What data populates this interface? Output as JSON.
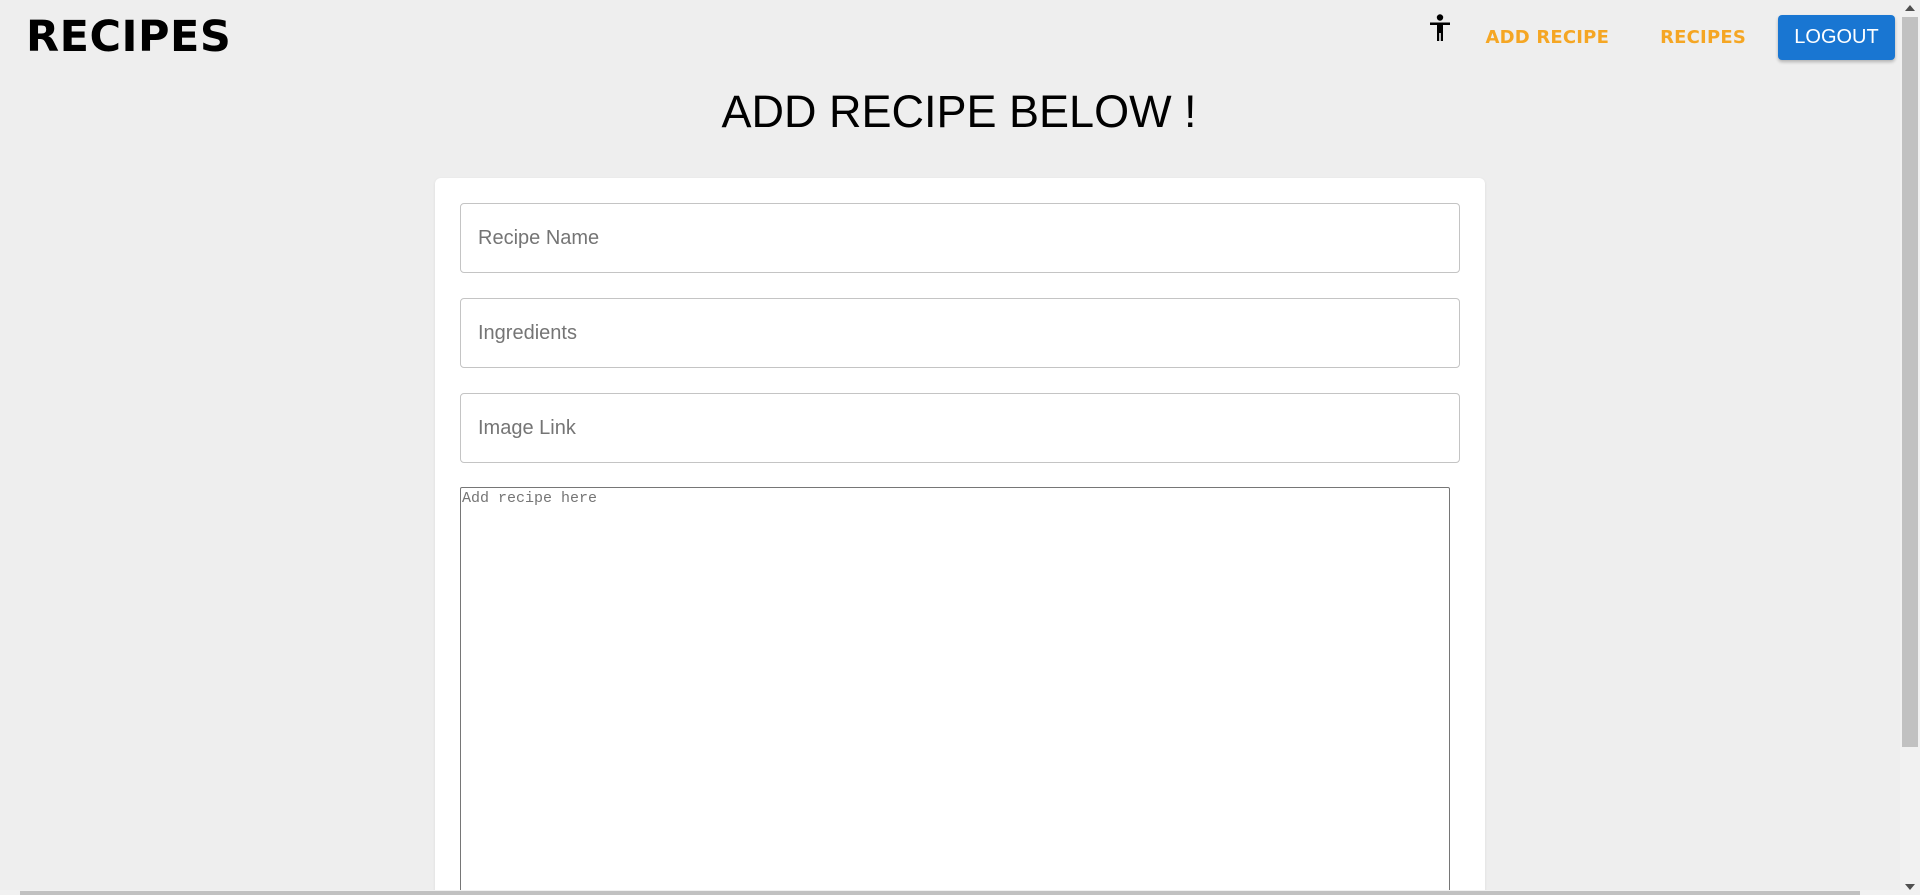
{
  "header": {
    "brand": "RECIPES",
    "accessibility_icon": "accessibility-person-icon",
    "nav": {
      "add_recipe": "ADD RECIPE",
      "recipes": "RECIPES",
      "logout": "LOGOUT"
    }
  },
  "main": {
    "title": "ADD RECIPE BELOW !",
    "form": {
      "recipe_name_placeholder": "Recipe Name",
      "ingredients_placeholder": "Ingredients",
      "image_link_placeholder": "Image Link",
      "recipe_text_placeholder": "Add recipe here"
    }
  },
  "colors": {
    "background": "#eeeeee",
    "nav_link": "#f5a623",
    "logout_button": "#1976d2"
  }
}
